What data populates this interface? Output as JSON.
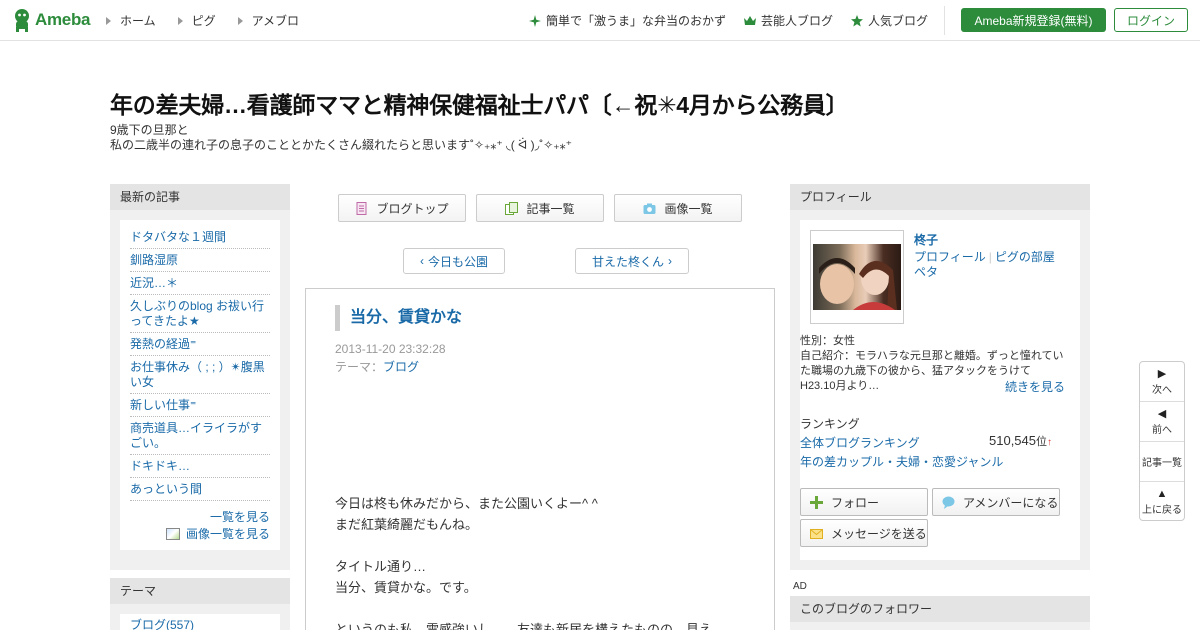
{
  "header": {
    "logo": "Ameba",
    "nav": [
      "ホーム",
      "ピグ",
      "アメブロ"
    ],
    "right_links": [
      {
        "label": "簡単で「激うま」な弁当のおかず",
        "icon": "sparkle-icon"
      },
      {
        "label": "芸能人ブログ",
        "icon": "crown-icon"
      },
      {
        "label": "人気ブログ",
        "icon": "star-icon"
      }
    ],
    "register_label": "Ameba新規登録(無料)",
    "login_label": "ログイン",
    "accent": "#2d8c3c"
  },
  "blog": {
    "title": "年の差夫婦…看護師ママと精神保健福祉士パパ〔←祝✳︎4月から公務員〕",
    "desc_line1": "9歳下の旦那と",
    "desc_line2": "私の二歳半の連れ子の息子のこととかたくさん綴れたらと思います˚✧₊⁎⁺ ◟( ᐛ )◞˚✧₊⁎⁺"
  },
  "recent": {
    "heading": "最新の記事",
    "items": [
      "ドタバタな１週間",
      "釧路湿原",
      "近況…＊",
      "久しぶりのblog お祓い行ってきたよ★",
      "発熱の経過⁼",
      "お仕事休み（ ; ; ）✴︎腹黒い女",
      "新しい仕事⁼",
      "商売道具…イライラがすごい。",
      "ドキドキ…",
      "あっという間"
    ],
    "more": "一覧を見る",
    "images_more": "画像一覧を見る"
  },
  "theme": {
    "heading": "テーマ",
    "first_item": "ブログ(557)"
  },
  "center_nav": {
    "top": "ブログトップ",
    "list": "記事一覧",
    "images": "画像一覧",
    "prev": "今日も公園",
    "next": "甘えた柊くん"
  },
  "article": {
    "title": "当分、賃貸かな",
    "date": "2013-11-20 23:32:28",
    "theme_label": "テーマ：",
    "theme": "ブログ",
    "body": [
      "今日は柊も休みだから、また公園いくよー^ ^",
      "まだ紅葉綺麗だもんね。",
      "",
      "タイトル通り…",
      "当分、賃貸かな。です。",
      "",
      "というのも私、霊感強いし…、友達も新居を構えたものの、見え"
    ]
  },
  "profile": {
    "heading": "プロフィール",
    "name": "柊子",
    "link_profile": "プロフィール",
    "link_pig": "ピグの部屋",
    "link_peta": "ペタ",
    "gender": "性別：女性",
    "intro": "自己紹介：モラハラな元旦那と離婚。ずっと憧れていた職場の九歳下の彼から、猛アタックをうけてH23.10月より…",
    "more": "続きを見る",
    "ranking_heading": "ランキング",
    "ranking_all": "全体ブログランキング",
    "ranking_value": "510,545",
    "ranking_unit": "位",
    "ranking_arrow": "↑",
    "ranking_genre": "年の差カップル・夫婦・恋愛ジャンル",
    "follow": "フォロー",
    "amember": "アメンバーになる",
    "message": "メッセージを送る"
  },
  "ad_label": "AD",
  "followers_heading": "このブログのフォロワー",
  "sidenav": {
    "next": "次へ",
    "prev": "前へ",
    "list": "記事一覧",
    "top": "上に戻る"
  }
}
